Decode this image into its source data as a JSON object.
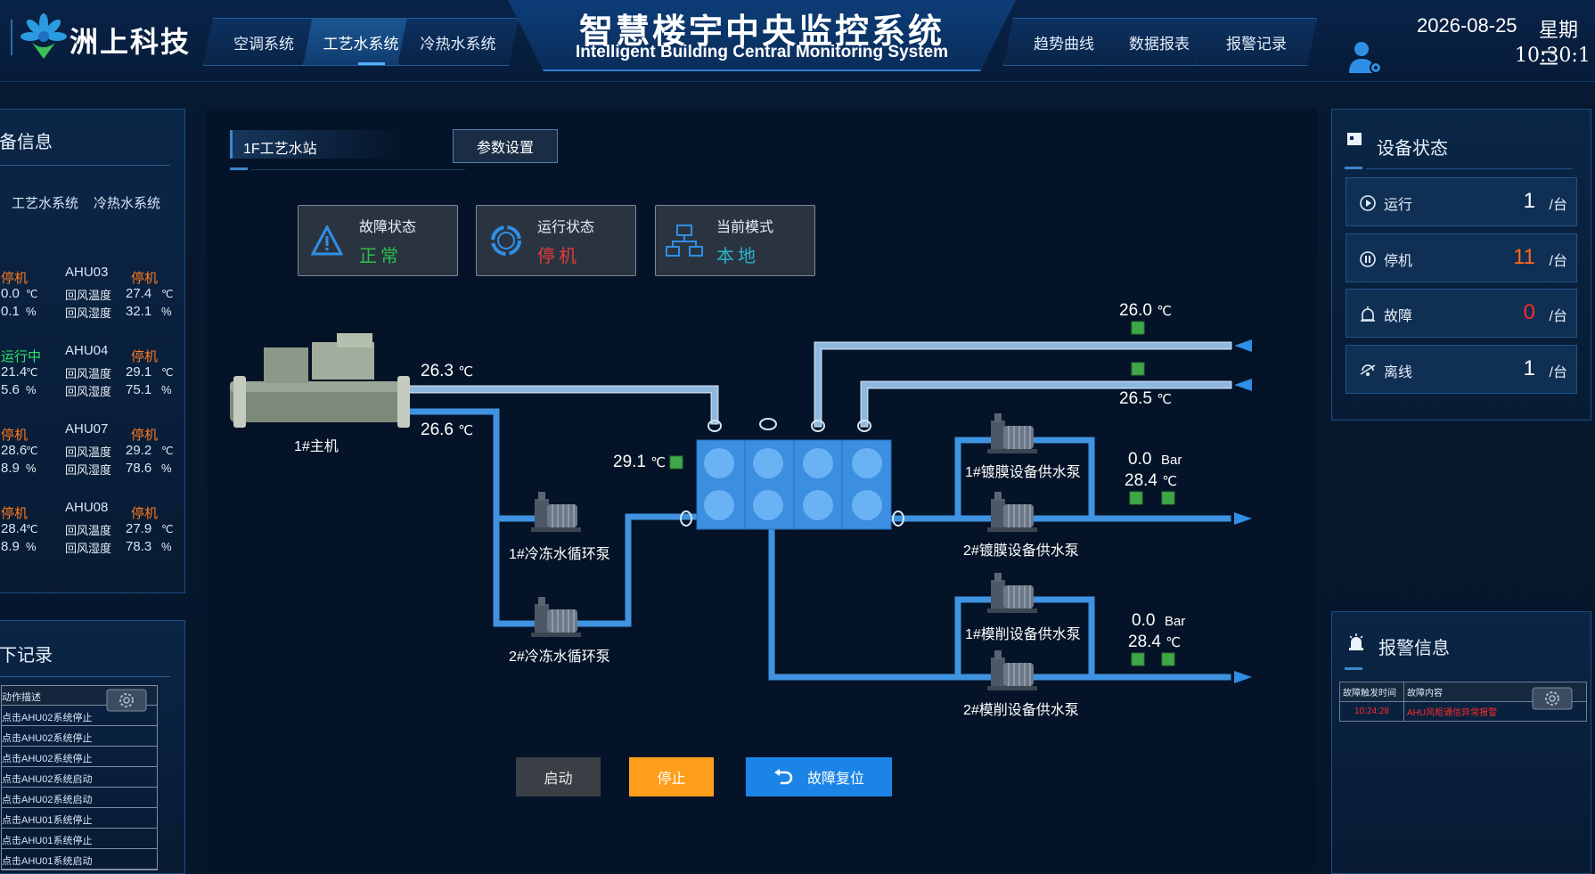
{
  "brand": {
    "logo_text": "洲上科技"
  },
  "nav": {
    "left": [
      {
        "label": "空调系统"
      },
      {
        "label": "工艺水系统"
      },
      {
        "label": "冷热水系统"
      }
    ],
    "right": [
      {
        "label": "趋势曲线"
      },
      {
        "label": "数据报表"
      },
      {
        "label": "报警记录"
      }
    ]
  },
  "title": {
    "cn": "智慧楼宇中央监控系统",
    "en": "Intelligent Building Central Monitoring System"
  },
  "clock": {
    "date": "2026-08-25",
    "weekday": "星期二",
    "time": "10:30:1"
  },
  "left_panel": {
    "title": "备信息",
    "tabs": [
      "工艺水系统",
      "冷热水系统"
    ],
    "rows": [
      {
        "left_status": "停机",
        "left_t": "0.0",
        "left_h": "0.1",
        "name": "AHU03",
        "status": "停机",
        "temp": "27.4",
        "hum": "32.1"
      },
      {
        "left_status": "运行中",
        "left_t": "21.4",
        "left_h": "5.6",
        "name": "AHU04",
        "status": "停机",
        "temp": "29.1",
        "hum": "75.1"
      },
      {
        "left_status": "停机",
        "left_t": "28.6",
        "left_h": "8.9",
        "name": "AHU07",
        "status": "停机",
        "temp": "29.2",
        "hum": "78.6"
      },
      {
        "left_status": "停机",
        "left_t": "28.4",
        "left_h": "8.9",
        "name": "AHU08",
        "status": "停机",
        "temp": "27.9",
        "hum": "78.3"
      }
    ],
    "temp_label": "回风温度",
    "hum_label": "回风湿度",
    "unit_c": "℃",
    "unit_pct": "%"
  },
  "log_panel": {
    "title": "下记录",
    "header": "动作描述",
    "rows": [
      "点击AHU02系统停止",
      "点击AHU02系统停止",
      "点击AHU02系统停止",
      "点击AHU02系统启动",
      "点击AHU02系统启动",
      "点击AHU01系统停止",
      "点击AHU01系统停止",
      "点击AHU01系统启动"
    ]
  },
  "station": {
    "name": "1F工艺水站",
    "param_btn": "参数设置"
  },
  "status_cards": [
    {
      "title": "故障状态",
      "value": "正常",
      "color": "#2dbd4a"
    },
    {
      "title": "运行状态",
      "value": "停机",
      "color": "#e23a3a"
    },
    {
      "title": "当前模式",
      "value": "本地",
      "color": "#2bb3c9"
    }
  ],
  "process": {
    "chiller_label": "1#主机",
    "t_supply": "26.3",
    "t_return": "26.6",
    "t_tank": "29.1",
    "t_out1": "26.0",
    "t_out2": "26.5",
    "coat_pressure": "0.0",
    "coat_temp": "28.4",
    "cut_pressure": "0.0",
    "cut_temp": "28.4",
    "unit_c": "℃",
    "unit_bar": "Bar",
    "pumps": {
      "chw1": "1#冷冻水循环泵",
      "chw2": "2#冷冻水循环泵",
      "coat1": "1#镀膜设备供水泵",
      "coat2": "2#镀膜设备供水泵",
      "cut1": "1#模削设备供水泵",
      "cut2": "2#模削设备供水泵"
    }
  },
  "controls": {
    "start": "启动",
    "stop": "停止",
    "reset": "故障复位"
  },
  "device_status": {
    "title": "设备状态",
    "rows": [
      {
        "name": "运行",
        "count": "1",
        "unit": "/台",
        "color": "#ffffff"
      },
      {
        "name": "停机",
        "count": "11",
        "unit": "/台",
        "color": "#ff6a1a"
      },
      {
        "name": "故障",
        "count": "0",
        "unit": "/台",
        "color": "#ff2a2a"
      },
      {
        "name": "离线",
        "count": "1",
        "unit": "/台",
        "color": "#ffffff"
      }
    ]
  },
  "alarm": {
    "title": "报警信息",
    "headers": [
      "故障触发时间",
      "故障内容"
    ],
    "rows": [
      {
        "time": "10:24:28",
        "content": "AHU风柜通信异常报警"
      }
    ]
  },
  "colors": {
    "accent": "#2f8fe6",
    "orange_btn": "#ff9e1a",
    "blue_btn": "#1b84e6",
    "stop_red": "#ff6a1a"
  }
}
